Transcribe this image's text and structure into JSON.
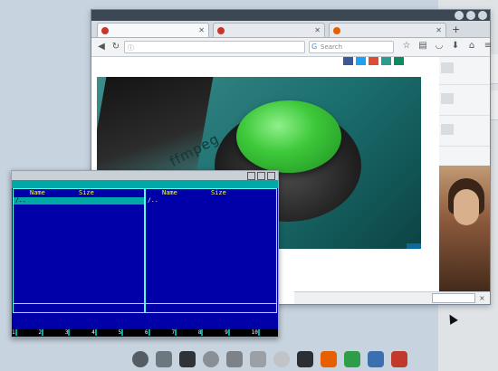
{
  "browser": {
    "tabs": [
      {
        "label": ""
      },
      {
        "label": ""
      },
      {
        "label": ""
      }
    ],
    "url": "",
    "search_placeholder": "Search",
    "new_tab": "+",
    "toolbar_icons": [
      "star-icon",
      "clipboard-icon",
      "pocket-icon",
      "download-icon",
      "home-icon",
      "menu-icon"
    ]
  },
  "page": {
    "breadcrumbs": "",
    "share_label": "",
    "social_colors": [
      "#3b5998",
      "#1da1f2",
      "#dd4b39",
      "#2a9d8f",
      "#0e8a5f"
    ],
    "hero": {
      "logo_text": "ffmpeg",
      "side_text": "",
      "caption": "",
      "credit": ""
    },
    "headline": "",
    "cookie": {
      "text": "",
      "button": "",
      "close": "×"
    },
    "sidebar": [
      {
        "text": ""
      },
      {
        "text": ""
      },
      {
        "text": ""
      }
    ]
  },
  "mc": {
    "title": "",
    "menu": [
      "",
      "",
      "",
      "",
      ""
    ],
    "left_panel": {
      "headers": {
        "name": "Name",
        "size": "Size",
        "time": ""
      },
      "rows": [
        {
          "name": "/..",
          "size": "",
          "time": "",
          "selected": true
        },
        {
          "name": "",
          "size": "",
          "time": ""
        },
        {
          "name": "",
          "size": "",
          "time": ""
        },
        {
          "name": "",
          "size": "",
          "time": ""
        },
        {
          "name": "",
          "size": "",
          "time": ""
        },
        {
          "name": "",
          "size": "",
          "time": ""
        },
        {
          "name": "",
          "size": "",
          "time": ""
        },
        {
          "name": "",
          "size": "",
          "time": ""
        },
        {
          "name": "",
          "size": "",
          "time": ""
        },
        {
          "name": "",
          "size": "",
          "time": ""
        },
        {
          "name": "",
          "size": "",
          "time": ""
        },
        {
          "name": "",
          "size": "",
          "time": ""
        },
        {
          "name": "",
          "size": "",
          "time": ""
        },
        {
          "name": "",
          "size": "",
          "time": ""
        },
        {
          "name": "",
          "size": "",
          "time": ""
        },
        {
          "name": "",
          "size": "",
          "time": ""
        }
      ],
      "footer": ""
    },
    "right_panel": {
      "headers": {
        "name": "Name",
        "size": "Size",
        "time": ""
      },
      "rows": [
        {
          "name": "/..",
          "size": "",
          "time": "",
          "selected": false
        },
        {
          "name": "",
          "size": "",
          "time": ""
        },
        {
          "name": "",
          "size": "",
          "time": ""
        },
        {
          "name": "",
          "size": "",
          "time": ""
        },
        {
          "name": "",
          "size": "",
          "time": ""
        },
        {
          "name": "",
          "size": "",
          "time": ""
        },
        {
          "name": "",
          "size": "",
          "time": ""
        },
        {
          "name": "",
          "size": "",
          "time": ""
        },
        {
          "name": "",
          "size": "",
          "time": ""
        },
        {
          "name": "",
          "size": "",
          "time": ""
        },
        {
          "name": "",
          "size": "",
          "time": ""
        },
        {
          "name": "",
          "size": "",
          "time": ""
        },
        {
          "name": "",
          "size": "",
          "time": ""
        },
        {
          "name": "",
          "size": "",
          "time": ""
        },
        {
          "name": "",
          "size": "",
          "time": ""
        },
        {
          "name": "",
          "size": "",
          "time": ""
        }
      ],
      "footer": ""
    },
    "hint": "",
    "cmdline": "",
    "fkeys": [
      {
        "n": "1",
        "label": ""
      },
      {
        "n": "2",
        "label": ""
      },
      {
        "n": "3",
        "label": ""
      },
      {
        "n": "4",
        "label": ""
      },
      {
        "n": "5",
        "label": ""
      },
      {
        "n": "6",
        "label": ""
      },
      {
        "n": "7",
        "label": ""
      },
      {
        "n": "8",
        "label": ""
      },
      {
        "n": "9",
        "label": ""
      },
      {
        "n": "10",
        "label": ""
      }
    ]
  },
  "dock": {
    "label": "",
    "items": [
      {
        "name": "power-icon",
        "color": "#555c63"
      },
      {
        "name": "pen-icon",
        "color": "#6d7780"
      },
      {
        "name": "terminal-icon",
        "color": "#2f3337"
      },
      {
        "name": "clock-icon",
        "color": "#8a8f95"
      },
      {
        "name": "settings-icon",
        "color": "#7c8288"
      },
      {
        "name": "printer-icon",
        "color": "#9aa0a6"
      },
      {
        "name": "speaker-icon",
        "color": "#c0c4c8"
      },
      {
        "name": "monitor-icon",
        "color": "#2b2f33"
      },
      {
        "name": "firefox-icon",
        "color": "#e66000"
      },
      {
        "name": "spreadsheet-icon",
        "color": "#2e9d47"
      },
      {
        "name": "files-icon",
        "color": "#3a6fb0"
      },
      {
        "name": "network-icon",
        "color": "#c0392b"
      }
    ]
  }
}
